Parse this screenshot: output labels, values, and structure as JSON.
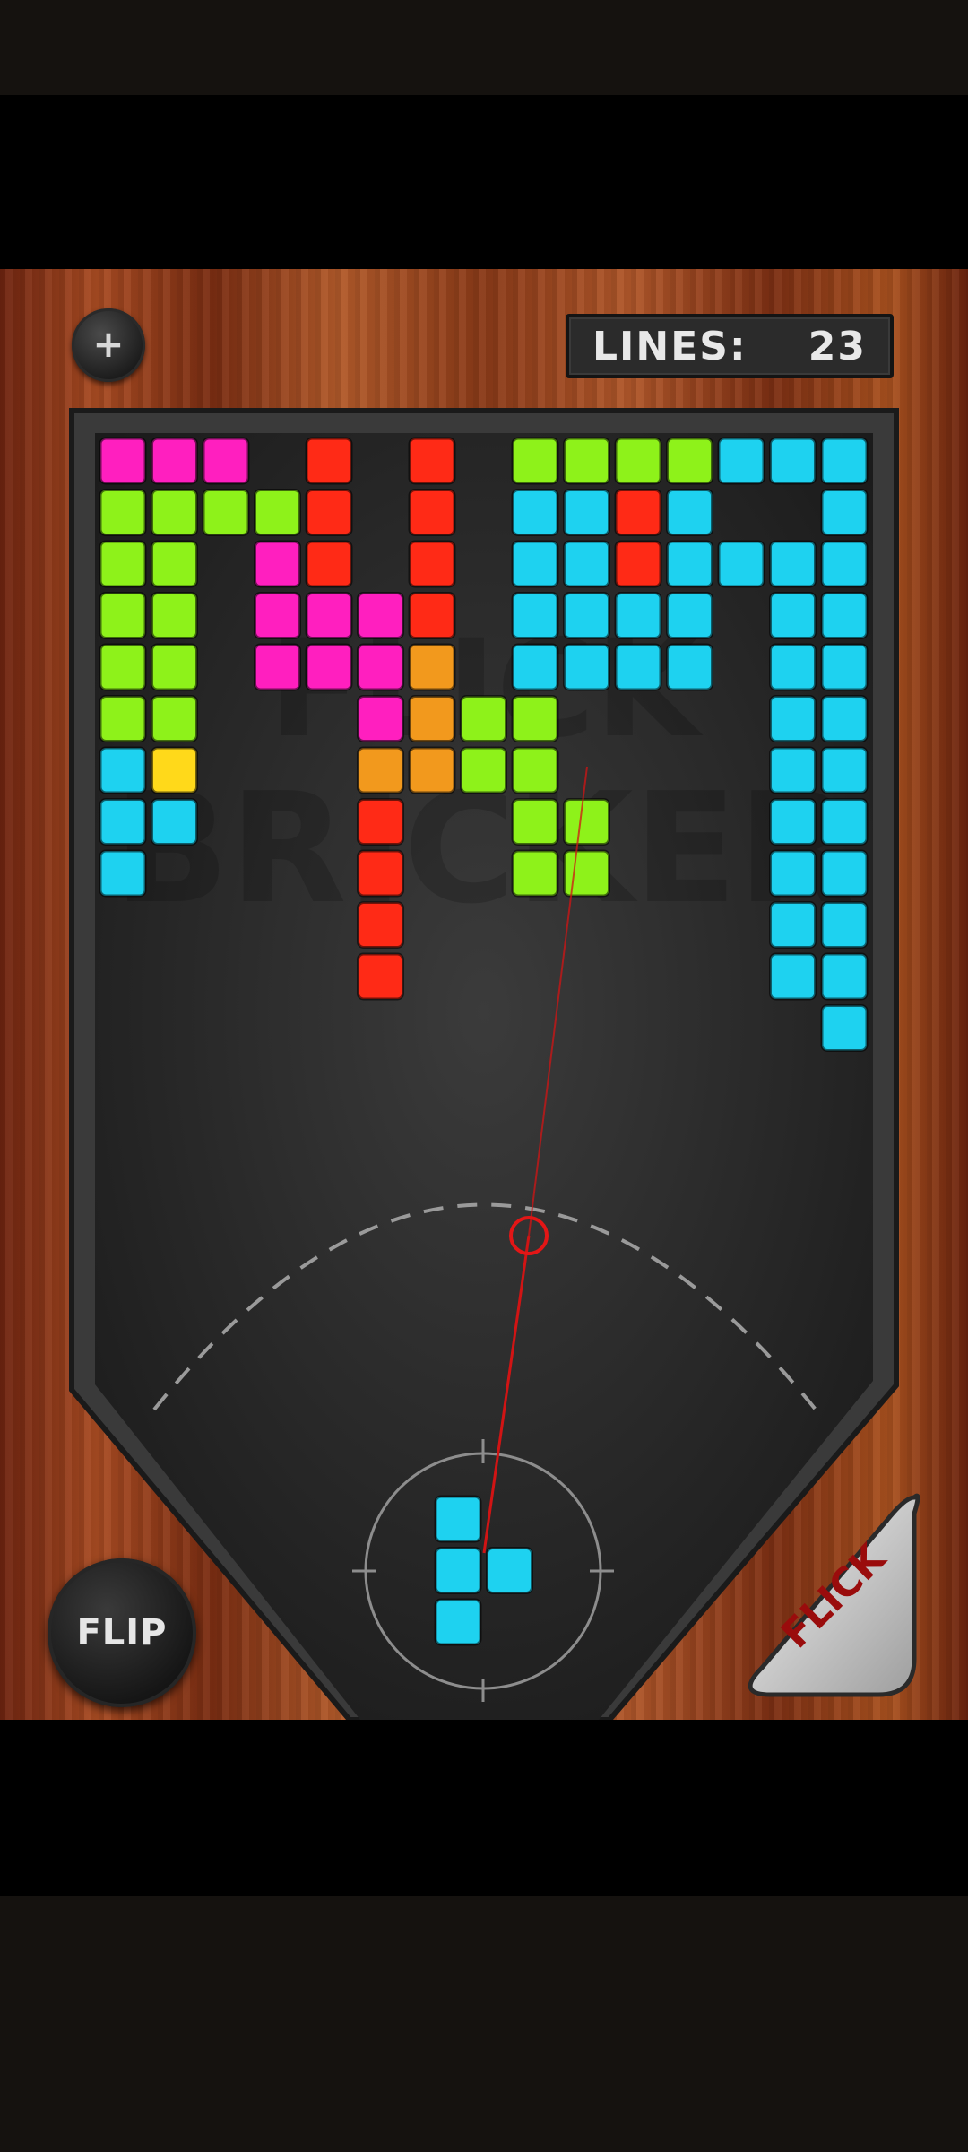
{
  "header": {
    "menu_icon": "plus-icon",
    "lines_label": "LINES:",
    "lines_value": "23"
  },
  "controls": {
    "flip_label": "FLIP",
    "flick_label": "FLICK"
  },
  "colors": {
    "magenta": "#ff1fbf",
    "lime": "#8ef21a",
    "red": "#ff2a16",
    "orange": "#f2991d",
    "cyan": "#1ed2f0",
    "yellow": "#ffd91a",
    "aim_line": "#d11414"
  },
  "board": {
    "columns": 15,
    "cells": [
      [
        0,
        0,
        "magenta"
      ],
      [
        1,
        0,
        "magenta"
      ],
      [
        2,
        0,
        "magenta"
      ],
      [
        4,
        0,
        "red"
      ],
      [
        6,
        0,
        "red"
      ],
      [
        8,
        0,
        "lime"
      ],
      [
        9,
        0,
        "lime"
      ],
      [
        10,
        0,
        "lime"
      ],
      [
        11,
        0,
        "lime"
      ],
      [
        12,
        0,
        "cyan"
      ],
      [
        13,
        0,
        "cyan"
      ],
      [
        14,
        0,
        "cyan"
      ],
      [
        0,
        1,
        "lime"
      ],
      [
        1,
        1,
        "lime"
      ],
      [
        2,
        1,
        "lime"
      ],
      [
        3,
        1,
        "lime"
      ],
      [
        4,
        1,
        "red"
      ],
      [
        6,
        1,
        "red"
      ],
      [
        8,
        1,
        "cyan"
      ],
      [
        9,
        1,
        "cyan"
      ],
      [
        10,
        1,
        "red"
      ],
      [
        11,
        1,
        "cyan"
      ],
      [
        14,
        1,
        "cyan"
      ],
      [
        0,
        2,
        "lime"
      ],
      [
        1,
        2,
        "lime"
      ],
      [
        3,
        2,
        "magenta"
      ],
      [
        4,
        2,
        "red"
      ],
      [
        6,
        2,
        "red"
      ],
      [
        8,
        2,
        "cyan"
      ],
      [
        9,
        2,
        "cyan"
      ],
      [
        10,
        2,
        "red"
      ],
      [
        11,
        2,
        "cyan"
      ],
      [
        12,
        2,
        "cyan"
      ],
      [
        13,
        2,
        "cyan"
      ],
      [
        14,
        2,
        "cyan"
      ],
      [
        0,
        3,
        "lime"
      ],
      [
        1,
        3,
        "lime"
      ],
      [
        3,
        3,
        "magenta"
      ],
      [
        4,
        3,
        "magenta"
      ],
      [
        5,
        3,
        "magenta"
      ],
      [
        6,
        3,
        "red"
      ],
      [
        8,
        3,
        "cyan"
      ],
      [
        9,
        3,
        "cyan"
      ],
      [
        10,
        3,
        "cyan"
      ],
      [
        11,
        3,
        "cyan"
      ],
      [
        13,
        3,
        "cyan"
      ],
      [
        14,
        3,
        "cyan"
      ],
      [
        0,
        4,
        "lime"
      ],
      [
        1,
        4,
        "lime"
      ],
      [
        3,
        4,
        "magenta"
      ],
      [
        4,
        4,
        "magenta"
      ],
      [
        5,
        4,
        "magenta"
      ],
      [
        6,
        4,
        "orange"
      ],
      [
        8,
        4,
        "cyan"
      ],
      [
        9,
        4,
        "cyan"
      ],
      [
        10,
        4,
        "cyan"
      ],
      [
        11,
        4,
        "cyan"
      ],
      [
        13,
        4,
        "cyan"
      ],
      [
        14,
        4,
        "cyan"
      ],
      [
        0,
        5,
        "lime"
      ],
      [
        1,
        5,
        "lime"
      ],
      [
        5,
        5,
        "magenta"
      ],
      [
        6,
        5,
        "orange"
      ],
      [
        7,
        5,
        "lime"
      ],
      [
        8,
        5,
        "lime"
      ],
      [
        13,
        5,
        "cyan"
      ],
      [
        14,
        5,
        "cyan"
      ],
      [
        0,
        6,
        "cyan"
      ],
      [
        1,
        6,
        "yellow"
      ],
      [
        5,
        6,
        "orange"
      ],
      [
        6,
        6,
        "orange"
      ],
      [
        7,
        6,
        "lime"
      ],
      [
        8,
        6,
        "lime"
      ],
      [
        13,
        6,
        "cyan"
      ],
      [
        14,
        6,
        "cyan"
      ],
      [
        0,
        7,
        "cyan"
      ],
      [
        1,
        7,
        "cyan"
      ],
      [
        5,
        7,
        "red"
      ],
      [
        8,
        7,
        "lime"
      ],
      [
        9,
        7,
        "lime"
      ],
      [
        13,
        7,
        "cyan"
      ],
      [
        14,
        7,
        "cyan"
      ],
      [
        0,
        8,
        "cyan"
      ],
      [
        5,
        8,
        "red"
      ],
      [
        8,
        8,
        "lime"
      ],
      [
        9,
        8,
        "lime"
      ],
      [
        13,
        8,
        "cyan"
      ],
      [
        14,
        8,
        "cyan"
      ],
      [
        5,
        9,
        "red"
      ],
      [
        13,
        9,
        "cyan"
      ],
      [
        14,
        9,
        "cyan"
      ],
      [
        5,
        10,
        "red"
      ],
      [
        13,
        10,
        "cyan"
      ],
      [
        14,
        10,
        "cyan"
      ],
      [
        14,
        11,
        "cyan"
      ]
    ]
  },
  "current_piece": {
    "color": "cyan",
    "cells": [
      [
        0,
        0
      ],
      [
        0,
        1
      ],
      [
        1,
        1
      ],
      [
        0,
        2
      ]
    ]
  },
  "watermark": {
    "line1": "FLICK",
    "line2": "BRICKER"
  }
}
